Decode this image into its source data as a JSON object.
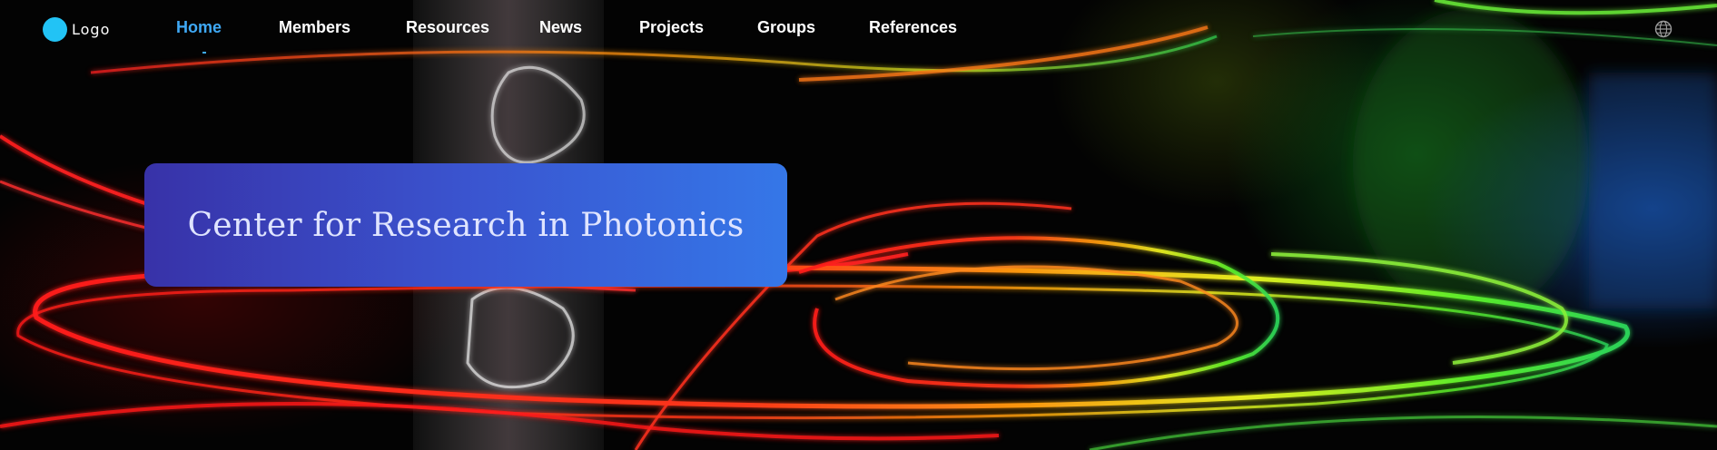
{
  "header": {
    "logo_text": "Logo",
    "nav": [
      {
        "label": "Home",
        "active": true
      },
      {
        "label": "Members",
        "active": false
      },
      {
        "label": "Resources",
        "active": false
      },
      {
        "label": "News",
        "active": false
      },
      {
        "label": "Projects",
        "active": false
      },
      {
        "label": "Groups",
        "active": false
      },
      {
        "label": "References",
        "active": false
      }
    ],
    "language_icon": "globe-icon"
  },
  "hero": {
    "title": "Center for Research in Photonics",
    "background": "colorful light trails photograph"
  },
  "colors": {
    "logo_mark": "#22c3f5",
    "nav_active": "#3fa9f5",
    "nav_text": "#ffffff",
    "card_gradient_start": "#3832a8",
    "card_gradient_end": "#3577e8",
    "title_text": "#dfe4ff"
  }
}
